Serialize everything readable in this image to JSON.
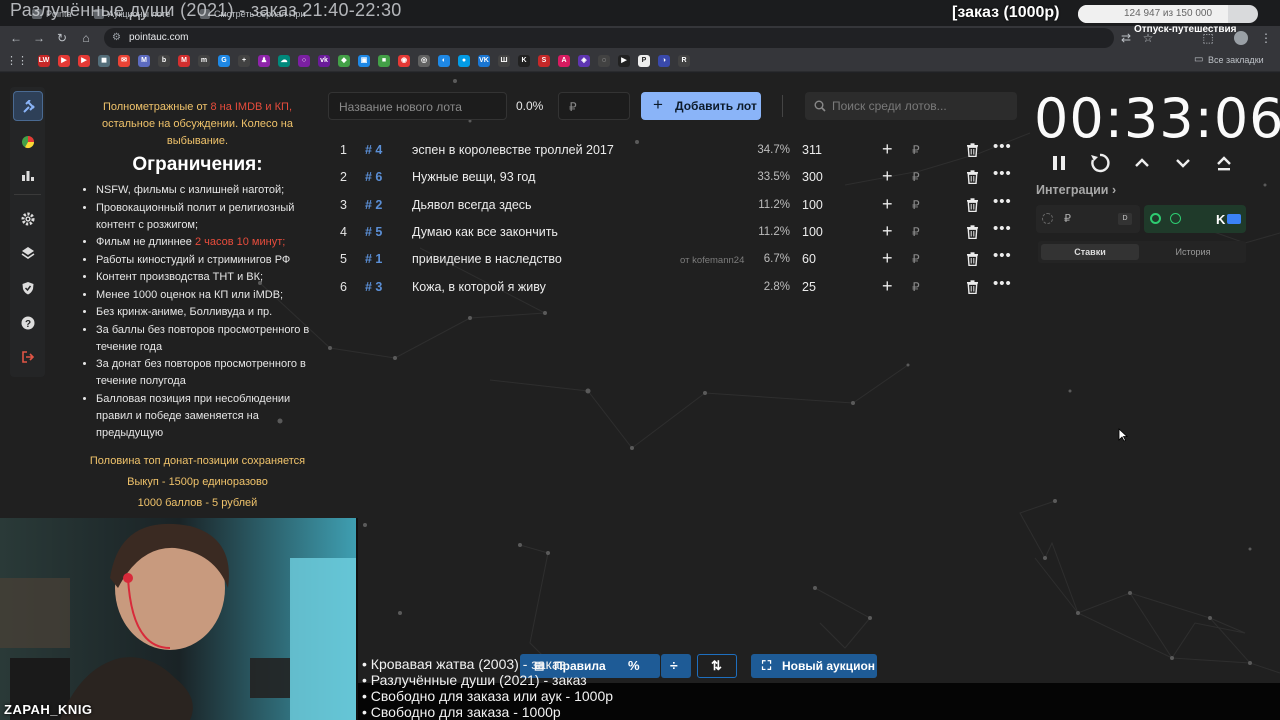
{
  "overlay": {
    "stream_title": "Разлучённые души (2021) - заказ 21:40-22:30",
    "order_label": "[заказ (1000р)",
    "goal_progress": "124 947 из 150 000",
    "goal_fraction": 0.833,
    "goal_subtitle": "Отпуск-путешествия"
  },
  "browser": {
    "tabs": [
      "Pointauc",
      "Аукционы лотерея",
      "Смотреть сериал Призраки"
    ],
    "url": "pointauc.com",
    "all_bookmarks": "Все закладки",
    "bookmarks": [
      {
        "label": "LW",
        "color": "#c62828"
      },
      {
        "label": "▶",
        "color": "#e53935"
      },
      {
        "label": "▶",
        "color": "#e53935"
      },
      {
        "label": "◼",
        "color": "#546e7a"
      },
      {
        "label": "✉",
        "color": "#ea4335"
      },
      {
        "label": "M",
        "color": "#5c6bc0"
      },
      {
        "label": "b",
        "color": "#424242"
      },
      {
        "label": "M",
        "color": "#d32f2f"
      },
      {
        "label": "m",
        "color": "#424242"
      },
      {
        "label": "G",
        "color": "#1e88e5"
      },
      {
        "label": "+",
        "color": "#424242"
      },
      {
        "label": "♟",
        "color": "#8e24aa"
      },
      {
        "label": "☁",
        "color": "#00897b"
      },
      {
        "label": "○",
        "color": "#7b1fa2"
      },
      {
        "label": "vk",
        "color": "#6a1b9a"
      },
      {
        "label": "◆",
        "color": "#43a047"
      },
      {
        "label": "▣",
        "color": "#1e88e5"
      },
      {
        "label": "■",
        "color": "#43a047"
      },
      {
        "label": "◉",
        "color": "#e53935"
      },
      {
        "label": "◎",
        "color": "#616161"
      },
      {
        "label": "◐",
        "color": "#1e88e5"
      },
      {
        "label": "●",
        "color": "#039be5"
      },
      {
        "label": "VK",
        "color": "#1976d2"
      },
      {
        "label": "Ш",
        "color": "#424242"
      },
      {
        "label": "K",
        "color": "#212121"
      },
      {
        "label": "S",
        "color": "#c62828"
      },
      {
        "label": "A",
        "color": "#d81b60"
      },
      {
        "label": "◈",
        "color": "#5e35b1"
      },
      {
        "label": "◌",
        "color": "#424242"
      },
      {
        "label": "▶",
        "color": "#212121"
      },
      {
        "label": "P",
        "color": "#eeeeee"
      },
      {
        "label": "◑",
        "color": "#3949ab"
      },
      {
        "label": "R",
        "color": "#424242"
      }
    ]
  },
  "rules": {
    "intro_1": "Полнометражные от",
    "intro_red": "8 на IMDB и КП,",
    "intro_2": "остальное на обсуждении. Колесо на выбывание.",
    "heading": "Ограничения:",
    "items": [
      "NSFW, фильмы с излишней наготой;",
      "Провокационный полит и религиозный контент с розжигом;",
      "Фильм не длиннее",
      "Работы киностудий и стриминигов РФ",
      "Контент производства ТНТ и ВК;",
      "Менее 1000 оценок на КП или iMDB;",
      "Без кринж-аниме, Болливуда и пр.",
      "За баллы без повторов просмотренного в течение года",
      "За донат без повторов просмотренного в течение полугода",
      "Балловая позиция при несоблюдении правил и победе заменяется на предыдущую"
    ],
    "length_limit": "2 часов 10 минут;",
    "footer": [
      "Половина топ донат-позиции сохраняется",
      "Выкуп - 1500р единоразово",
      "1000 баллов - 5 рублей"
    ]
  },
  "lot_form": {
    "name_placeholder": "Название нового лота",
    "percent": "0.0%",
    "sum_placeholder": "₽",
    "add_button": "Добавить лот",
    "search_placeholder": "Поиск среди лотов..."
  },
  "lots": [
    {
      "num": "1",
      "id": "# 4",
      "name": "эспен в королевстве троллей 2017",
      "from": "",
      "pct": "34.7%",
      "amount": "311"
    },
    {
      "num": "2",
      "id": "# 6",
      "name": "Нужные вещи, 93 год",
      "from": "",
      "pct": "33.5%",
      "amount": "300"
    },
    {
      "num": "3",
      "id": "# 2",
      "name": "Дьявол всегда здесь",
      "from": "",
      "pct": "11.2%",
      "amount": "100"
    },
    {
      "num": "4",
      "id": "# 5",
      "name": "Думаю как все закончить",
      "from": "",
      "pct": "11.2%",
      "amount": "100"
    },
    {
      "num": "5",
      "id": "# 1",
      "name": "привидение в наследство",
      "from": "от kofemann24",
      "pct": "6.7%",
      "amount": "60"
    },
    {
      "num": "6",
      "id": "# 3",
      "name": "Кожа, в которой я живу",
      "from": "",
      "pct": "2.8%",
      "amount": "25"
    }
  ],
  "currency": "₽",
  "timer": {
    "value": "00:33:06"
  },
  "integrations": {
    "title": "Интеграции",
    "tab_bets": "Ставки",
    "tab_history": "История",
    "currency": "₽"
  },
  "bottom": {
    "rules_button": "Правила",
    "new_auction_button": "Новый аукцион"
  },
  "orders_overlay": [
    "• Кровавая жатва (2003) - заказ",
    "• Разлучённые души (2021) - заказ",
    "• Свободно для заказа или аук - 1000р",
    "• Свободно для заказа - 1000р"
  ],
  "webcam": {
    "streamer_name": "ZAPAH_KNIG"
  },
  "colors": {
    "accent": "#8ab4f8",
    "lot_id": "#5b8fd6",
    "warning": "#e74c3c",
    "rules_note": "#f0c36b",
    "bottom_button": "#1e5b96"
  }
}
